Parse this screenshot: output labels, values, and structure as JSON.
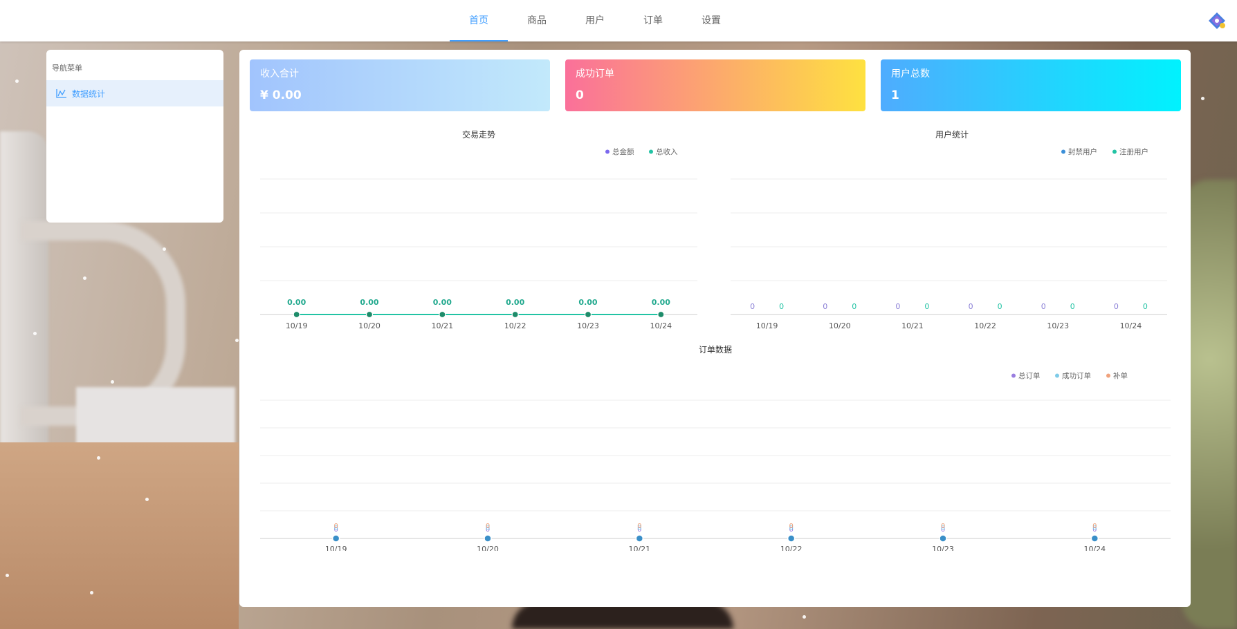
{
  "nav": {
    "items": [
      "首页",
      "商品",
      "用户",
      "订单",
      "设置"
    ],
    "active_index": 0
  },
  "sidebar": {
    "title": "导航菜单",
    "items": [
      {
        "label": "数据统计",
        "icon": "line-chart-icon"
      }
    ]
  },
  "cards": [
    {
      "title": "收入合计",
      "value": "¥ 0.00"
    },
    {
      "title": "成功订单",
      "value": "0"
    },
    {
      "title": "用户总数",
      "value": "1"
    }
  ],
  "chart_data": [
    {
      "type": "line",
      "title": "交易走势",
      "x": [
        "10/19",
        "10/20",
        "10/21",
        "10/22",
        "10/23",
        "10/24"
      ],
      "series": [
        {
          "name": "总金额",
          "color": "#7b68ee",
          "values": [
            0,
            0,
            0,
            0,
            0,
            0
          ]
        },
        {
          "name": "总收入",
          "color": "#22c3a4",
          "values": [
            0,
            0,
            0,
            0,
            0,
            0
          ]
        }
      ],
      "data_labels": [
        "0.00",
        "0.00",
        "0.00",
        "0.00",
        "0.00",
        "0.00"
      ],
      "legend": "top-right",
      "grid": true
    },
    {
      "type": "bar",
      "title": "用户统计",
      "categories": [
        "10/19",
        "10/20",
        "10/21",
        "10/22",
        "10/23",
        "10/24"
      ],
      "series": [
        {
          "name": "封禁用户",
          "color": "#3b8fd8",
          "values": [
            0,
            0,
            0,
            0,
            0,
            0
          ]
        },
        {
          "name": "注册用户",
          "color": "#22c3a4",
          "values": [
            0,
            0,
            0,
            0,
            0,
            0
          ]
        }
      ],
      "legend": "top-right",
      "grid": true
    },
    {
      "type": "line",
      "title": "订单数据",
      "x": [
        "10/19",
        "10/20",
        "10/21",
        "10/22",
        "10/23",
        "10/24"
      ],
      "series": [
        {
          "name": "总订单",
          "color": "#9a7ee0",
          "values": [
            0,
            0,
            0,
            0,
            0,
            0
          ]
        },
        {
          "name": "成功订单",
          "color": "#7ecbe8",
          "values": [
            0,
            0,
            0,
            0,
            0,
            0
          ]
        },
        {
          "name": "补单",
          "color": "#f0a27c",
          "values": [
            0,
            0,
            0,
            0,
            0,
            0
          ]
        }
      ],
      "legend": "top-right",
      "grid": true
    }
  ]
}
